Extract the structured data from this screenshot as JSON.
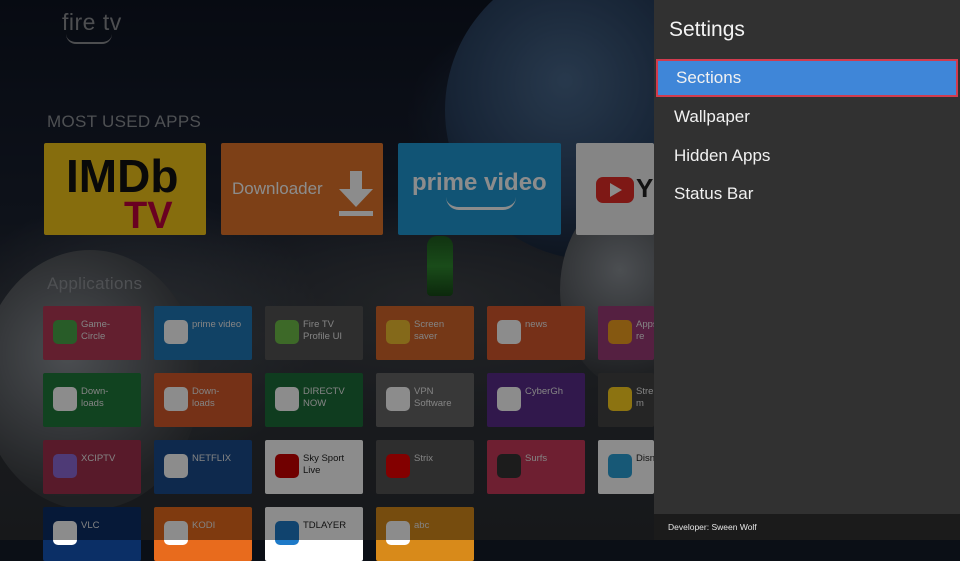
{
  "brand": "fire tv",
  "sections": {
    "most_used_title": "MOST USED APPS",
    "applications_title": "Applications"
  },
  "most_used_apps": [
    {
      "name": "IMDb",
      "name2": "TV"
    },
    {
      "name": "Downloader"
    },
    {
      "name": "prime video"
    },
    {
      "name": "YouTube"
    }
  ],
  "applications": [
    {
      "label": "Game-Circle",
      "text": "Game-\nCircle"
    },
    {
      "label": "prime video",
      "text": "prime video"
    },
    {
      "label": "Fire TV Profile UI",
      "text": "Fire TV\nProfile UI"
    },
    {
      "label": "Screen saver",
      "text": "Screen\nsaver"
    },
    {
      "label": "news",
      "text": "news"
    },
    {
      "label": "Appstore",
      "text": "Appsto\nre"
    },
    {
      "label": "Downloads",
      "text": "Down-\nloads"
    },
    {
      "label": "Downloads 2",
      "text": "Down-\nloads"
    },
    {
      "label": "DIRECTV NOW",
      "text": "DIRECTV\nNOW"
    },
    {
      "label": "VPN Software",
      "text": "VPN\nSoftware"
    },
    {
      "label": "CyberGhost",
      "text": "CyberGh"
    },
    {
      "label": "Stremium",
      "text": "Stremiu\nm"
    },
    {
      "label": "XCIPTV PLAYER",
      "text": "XCIPTV"
    },
    {
      "label": "NETFLIX",
      "text": "NETFLIX"
    },
    {
      "label": "Sky Sport Live",
      "text": "Sky Sport\nLive"
    },
    {
      "label": "Strix",
      "text": "Strix"
    },
    {
      "label": "Surfshark",
      "text": "Surfs"
    },
    {
      "label": "Disney+",
      "text": "Disney+"
    },
    {
      "label": "VLC",
      "text": "VLC"
    },
    {
      "label": "KODI",
      "text": "KODI"
    },
    {
      "label": "TDLAYER",
      "text": "TDLAYER"
    },
    {
      "label": "abc",
      "text": "abc"
    }
  ],
  "settings": {
    "title": "Settings",
    "items": [
      {
        "label": "Sections",
        "selected": true
      },
      {
        "label": "Wallpaper",
        "selected": false
      },
      {
        "label": "Hidden Apps",
        "selected": false
      },
      {
        "label": "Status Bar",
        "selected": false
      }
    ],
    "footer": "Developer:  Sween Wolf"
  },
  "colors": {
    "panel_bg": "#313131",
    "selection": "#3f86d8",
    "focus_border": "#d23b4e"
  }
}
